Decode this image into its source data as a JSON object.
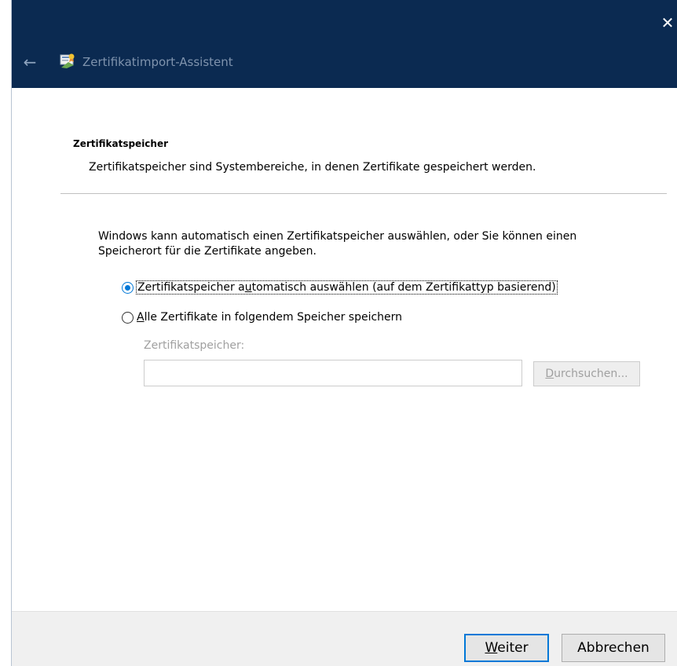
{
  "window": {
    "close_glyph": "✕",
    "back_glyph": "←",
    "title": "Zertifikatimport-Assistent",
    "title_icon": "certificate-wizard-icon",
    "titlebar_color": "#0b2a51"
  },
  "header": {
    "section_title": "Zertifikatspeicher",
    "section_description": "Zertifikatspeicher sind Systembereiche, in denen Zertifikate gespeichert werden."
  },
  "body": {
    "intro": "Windows kann automatisch einen Zertifikatspeicher auswählen, oder Sie können einen Speicherort für die Zertifikate angeben.",
    "options": [
      {
        "label_before": "Zertifikatspeicher a",
        "mnemonic": "u",
        "label_after": "tomatisch auswählen (auf dem Zertifikattyp basierend)",
        "selected": true
      },
      {
        "label_before": "",
        "mnemonic": "A",
        "label_after": "lle Zertifikate in folgendem Speicher speichern",
        "selected": false
      }
    ],
    "store": {
      "label": "Zertifikatspeicher:",
      "value": "",
      "browse_mnemonic": "D",
      "browse_rest": "urchsuchen..."
    }
  },
  "footer": {
    "next_mnemonic": "W",
    "next_rest": "eiter",
    "cancel_label": "Abbrechen"
  },
  "colors": {
    "accent": "#0078d7",
    "disabled_text": "#a0a0a0",
    "footer_bg": "#f0f0f0"
  }
}
